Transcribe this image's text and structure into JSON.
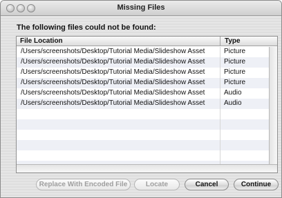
{
  "window": {
    "title": "Missing Files"
  },
  "dialog": {
    "message": "The following files could not be found:"
  },
  "table": {
    "headers": {
      "location": "File Location",
      "type": "Type"
    },
    "rows": [
      {
        "location": "/Users/screenshots/Desktop/Tutorial Media/Slideshow Asset",
        "type": "Picture"
      },
      {
        "location": "/Users/screenshots/Desktop/Tutorial Media/Slideshow Asset",
        "type": "Picture"
      },
      {
        "location": "/Users/screenshots/Desktop/Tutorial Media/Slideshow Asset",
        "type": "Picture"
      },
      {
        "location": "/Users/screenshots/Desktop/Tutorial Media/Slideshow Asset",
        "type": "Picture"
      },
      {
        "location": "/Users/screenshots/Desktop/Tutorial Media/Slideshow Asset",
        "type": "Audio"
      },
      {
        "location": "/Users/screenshots/Desktop/Tutorial Media/Slideshow Asset",
        "type": "Audio"
      }
    ]
  },
  "buttons": {
    "replace": "Replace With Encoded File",
    "locate": "Locate",
    "cancel": "Cancel",
    "continue": "Continue"
  }
}
